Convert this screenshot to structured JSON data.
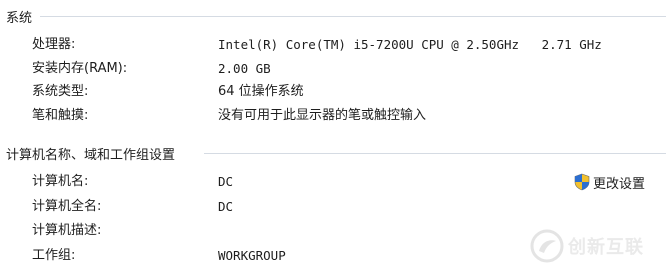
{
  "system": {
    "header": "系统",
    "rows": [
      {
        "label": "处理器:",
        "value": "Intel(R) Core(TM) i5-7200U CPU @ 2.50GHz   2.71 GHz"
      },
      {
        "label": "安装内存(RAM):",
        "value": "2.00 GB"
      },
      {
        "label": "系统类型:",
        "value": "64 位操作系统"
      },
      {
        "label": "笔和触摸:",
        "value": "没有可用于此显示器的笔或触控输入"
      }
    ]
  },
  "computer": {
    "header": "计算机名称、域和工作组设置",
    "change_settings_label": "更改设置",
    "change_settings_icon": "uac-shield-icon",
    "rows": [
      {
        "label": "计算机名:",
        "value": "DC"
      },
      {
        "label": "计算机全名:",
        "value": "DC"
      },
      {
        "label": "计算机描述:",
        "value": ""
      },
      {
        "label": "工作组:",
        "value": "WORKGROUP"
      }
    ]
  },
  "watermark": {
    "text": "创新互联",
    "icon": "watermark-logo-icon"
  },
  "colors": {
    "rule": "#d5dbe3",
    "shield_blue": "#2c6fd1",
    "shield_yellow": "#f2c12e"
  }
}
